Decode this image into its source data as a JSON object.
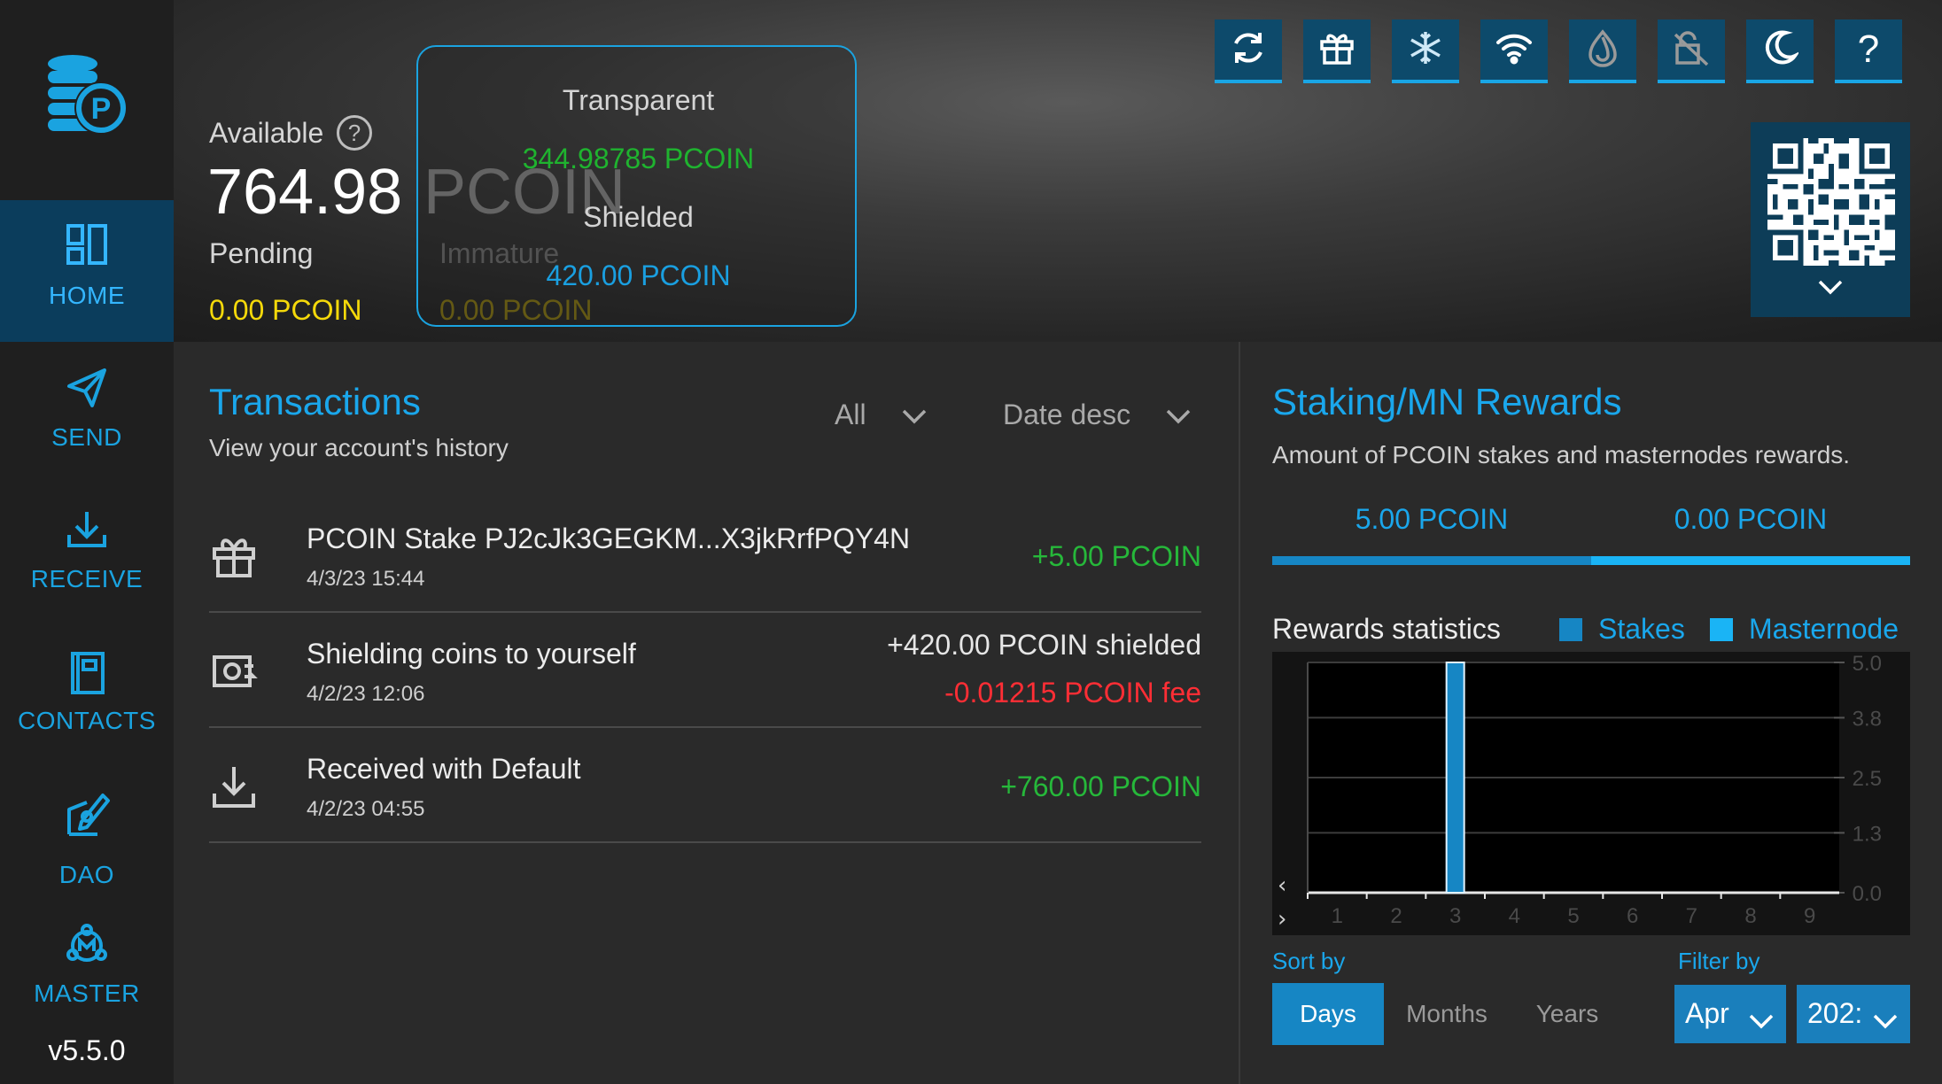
{
  "sidebar": {
    "items": [
      {
        "label": "HOME",
        "icon": "home-grid-icon"
      },
      {
        "label": "SEND",
        "icon": "paper-plane-icon"
      },
      {
        "label": "RECEIVE",
        "icon": "download-icon"
      },
      {
        "label": "CONTACTS",
        "icon": "address-book-icon"
      },
      {
        "label": "DAO",
        "icon": "dao-sign-icon"
      },
      {
        "label": "MASTER",
        "icon": "masternode-icon"
      }
    ],
    "version": "v5.5.0"
  },
  "balances": {
    "available_label": "Available",
    "available_value": "764.98",
    "available_unit": "PCOIN",
    "pending_label": "Pending",
    "pending_value": "0.00 PCOIN",
    "immature_label": "Immature",
    "immature_value": "0.00 PCOIN"
  },
  "popup": {
    "transparent_label": "Transparent",
    "transparent_value": "344.98785 PCOIN",
    "shielded_label": "Shielded",
    "shielded_value": "420.00 PCOIN"
  },
  "toolbar": {
    "help_label": "?"
  },
  "transactions": {
    "title": "Transactions",
    "subtitle": "View your account's history",
    "filter_type": "All",
    "filter_sort": "Date desc",
    "rows": [
      {
        "title": "PCOIN Stake PJ2cJk3GEGKM...X3jkRrfPQY4N",
        "date": "4/3/23 15:44",
        "amount": "+5.00 PCOIN"
      },
      {
        "title": "Shielding coins to yourself",
        "date": "4/2/23 12:06",
        "amount": "+420.00 PCOIN shielded",
        "fee": "-0.01215 PCOIN fee"
      },
      {
        "title": "Received with Default",
        "date": "4/2/23 04:55",
        "amount": "+760.00 PCOIN"
      }
    ]
  },
  "staking": {
    "title": "Staking/MN Rewards",
    "subtitle": "Amount of PCOIN stakes and masternodes rewards.",
    "stakes_total": "5.00 PCOIN",
    "masternode_total": "0.00 PCOIN",
    "stats_label": "Rewards statistics",
    "legend_stakes": "Stakes",
    "legend_masternode": "Masternode",
    "sort_by_label": "Sort by",
    "filter_by_label": "Filter by",
    "sort_options": [
      "Days",
      "Months",
      "Years"
    ],
    "month_value": "Apr",
    "year_value": "202:",
    "colors": {
      "stakes": "#1686c4",
      "masternode": "#1ab4f5"
    }
  },
  "chart_data": {
    "type": "bar",
    "categories": [
      "1",
      "2",
      "3",
      "4",
      "5",
      "6",
      "7",
      "8",
      "9"
    ],
    "series": [
      {
        "name": "Stakes",
        "values": [
          0,
          0,
          5.0,
          0,
          0,
          0,
          0,
          0,
          0
        ]
      },
      {
        "name": "Masternode",
        "values": [
          0,
          0,
          0,
          0,
          0,
          0,
          0,
          0,
          0
        ]
      }
    ],
    "yticks": [
      "5.0",
      "3.8",
      "2.5",
      "1.3",
      "0.0"
    ],
    "ylim": [
      0,
      5.0
    ],
    "grid": true
  }
}
